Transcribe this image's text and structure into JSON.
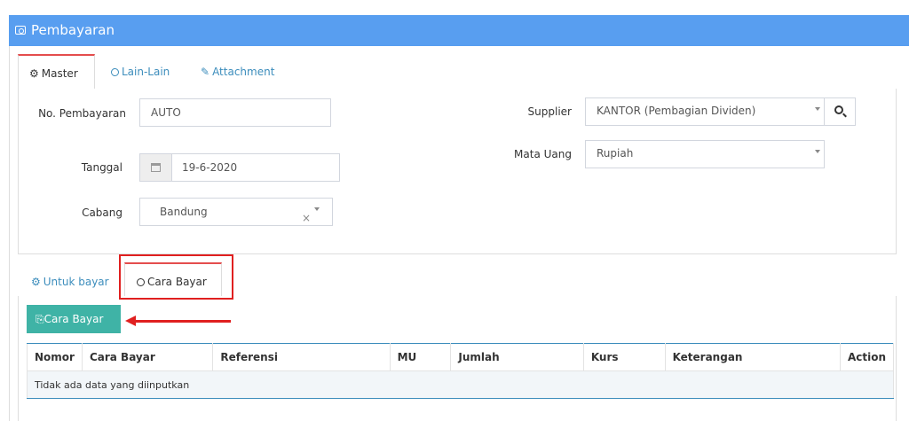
{
  "header": {
    "title": "Pembayaran",
    "icon": "money-icon"
  },
  "colors": {
    "header_bg": "#589ef0",
    "active_tab_border": "#e44d4d",
    "button_teal": "#3fb3a6",
    "annotation_red": "#e02020"
  },
  "top_tabs": [
    {
      "label": "Master",
      "icon": "gears-icon",
      "active": true
    },
    {
      "label": "Lain-Lain",
      "icon": "check-circle-icon",
      "active": false
    },
    {
      "label": "Attachment",
      "icon": "paperclip-icon",
      "active": false
    }
  ],
  "form": {
    "no_pembayaran": {
      "label": "No. Pembayaran",
      "value": "AUTO"
    },
    "tanggal": {
      "label": "Tanggal",
      "value": "19-6-2020"
    },
    "cabang": {
      "label": "Cabang",
      "value": "Bandung"
    },
    "supplier": {
      "label": "Supplier",
      "value": "KANTOR (Pembagian Dividen)"
    },
    "mata_uang": {
      "label": "Mata Uang",
      "value": "Rupiah"
    }
  },
  "bottom_tabs": [
    {
      "label": "Untuk bayar",
      "icon": "gears-icon",
      "active": false
    },
    {
      "label": "Cara Bayar",
      "icon": "check-circle-icon",
      "active": true
    }
  ],
  "add_button": {
    "label": "Cara Bayar",
    "icon": "copy-icon"
  },
  "table": {
    "columns": [
      "Nomor",
      "Cara Bayar",
      "Referensi",
      "MU",
      "Jumlah",
      "Kurs",
      "Keterangan",
      "Action"
    ],
    "empty_text": "Tidak ada data yang diinputkan"
  }
}
